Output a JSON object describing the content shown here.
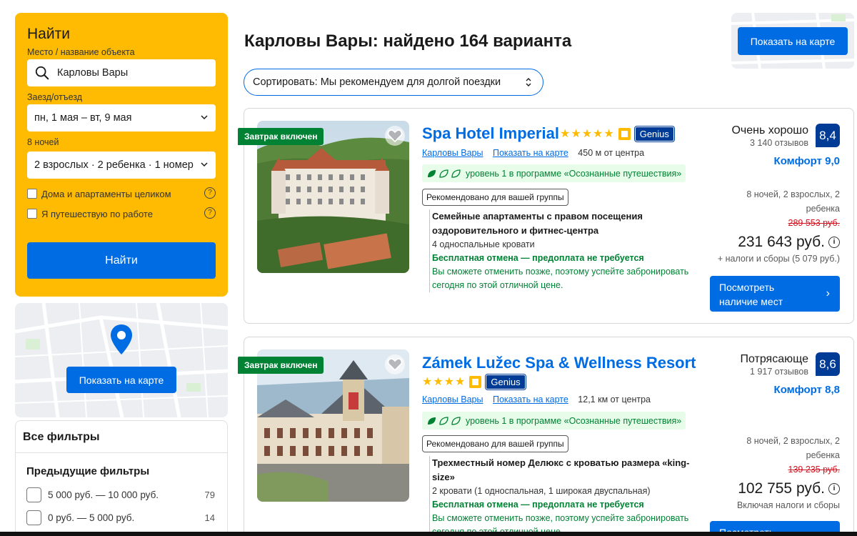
{
  "search": {
    "title": "Найти",
    "place_label": "Место / название объекта",
    "place_value": "Карловы Вары",
    "dates_label": "Заезд/отъезд",
    "dates_value": "пн, 1 мая – вт, 9 мая",
    "nights_label": "8 ночей",
    "guests_value": "2 взрослых · 2 ребенка · 1 номер",
    "check_homes": "Дома и апартаменты целиком",
    "check_work": "Я путешествую по работе",
    "submit_label": "Найти"
  },
  "map": {
    "button_label": "Показать на карте"
  },
  "filters": {
    "title": "Все фильтры",
    "previous_title": "Предыдущие фильтры",
    "items": [
      {
        "label": "5 000 руб. — 10 000 руб.",
        "count": "79"
      },
      {
        "label": "0 руб. — 5 000 руб.",
        "count": "14"
      }
    ]
  },
  "results": {
    "title": "Карловы Вары: найдено 164 варианта",
    "sort_label": "Сортировать: Мы рекомендуем для долгой поездки",
    "map_button": "Показать на карте"
  },
  "hotels": [
    {
      "badge": "Завтрак включен",
      "name": "Spa Hotel Imperial",
      "stars": 5,
      "genius": "Genius",
      "city_link": "Карловы Вары",
      "map_link": "Показать на карте",
      "distance": "450 м от центра",
      "eco": "уровень 1 в программе «Осознанные путешествия»",
      "recommended": "Рекомендовано для вашей группы",
      "room_name": "Семейные апартаменты с правом посещения оздоровительного и фитнес-центра",
      "beds": "4 односпальные кровати",
      "free_cancel": "Бесплатная отмена — предоплата не требуется",
      "cancel_note": "Вы сможете отменить позже, поэтому успейте забронировать сегодня по этой отличной цене.",
      "rating_word": "Очень хорошо",
      "reviews": "3 140 отзывов",
      "score": "8,4",
      "comfort": "Комфорт 9,0",
      "stay_info": "8 ночей, 2 взрослых, 2 ребенка",
      "old_price": "289 553 руб.",
      "price": "231 643 руб.",
      "taxes": "+ налоги и сборы (5 079 руб.)",
      "button": "Посмотреть наличие мест"
    },
    {
      "badge": "Завтрак включен",
      "name": "Zámek Lužec Spa & Wellness Resort",
      "stars": 4,
      "genius": "Genius",
      "city_link": "Карловы Вары",
      "map_link": "Показать на карте",
      "distance": "12,1 км от центра",
      "eco": "уровень 1 в программе «Осознанные путешествия»",
      "recommended": "Рекомендовано для вашей группы",
      "room_name": "Трехместный номер Делюкс с кроватью размера «king-size»",
      "beds": "2 кровати (1 односпальная, 1 широкая двуспальная)",
      "free_cancel": "Бесплатная отмена — предоплата не требуется",
      "cancel_note": "Вы сможете отменить позже, поэтому успейте забронировать сегодня по этой отличной цене.",
      "rating_word": "Потрясающе",
      "reviews": "1 917 отзывов",
      "score": "8,6",
      "comfort": "Комфорт 8,8",
      "stay_info": "8 ночей, 2 взрослых, 2 ребенка",
      "old_price": "139 235 руб.",
      "price": "102 755 руб.",
      "taxes": "Включая налоги и сборы",
      "button": "Посмотреть наличие мест"
    }
  ],
  "colors": {
    "brand_blue": "#006ce4",
    "dark_blue": "#003b95",
    "yellow": "#febb02",
    "green": "#008234",
    "red": "#d4111e"
  }
}
